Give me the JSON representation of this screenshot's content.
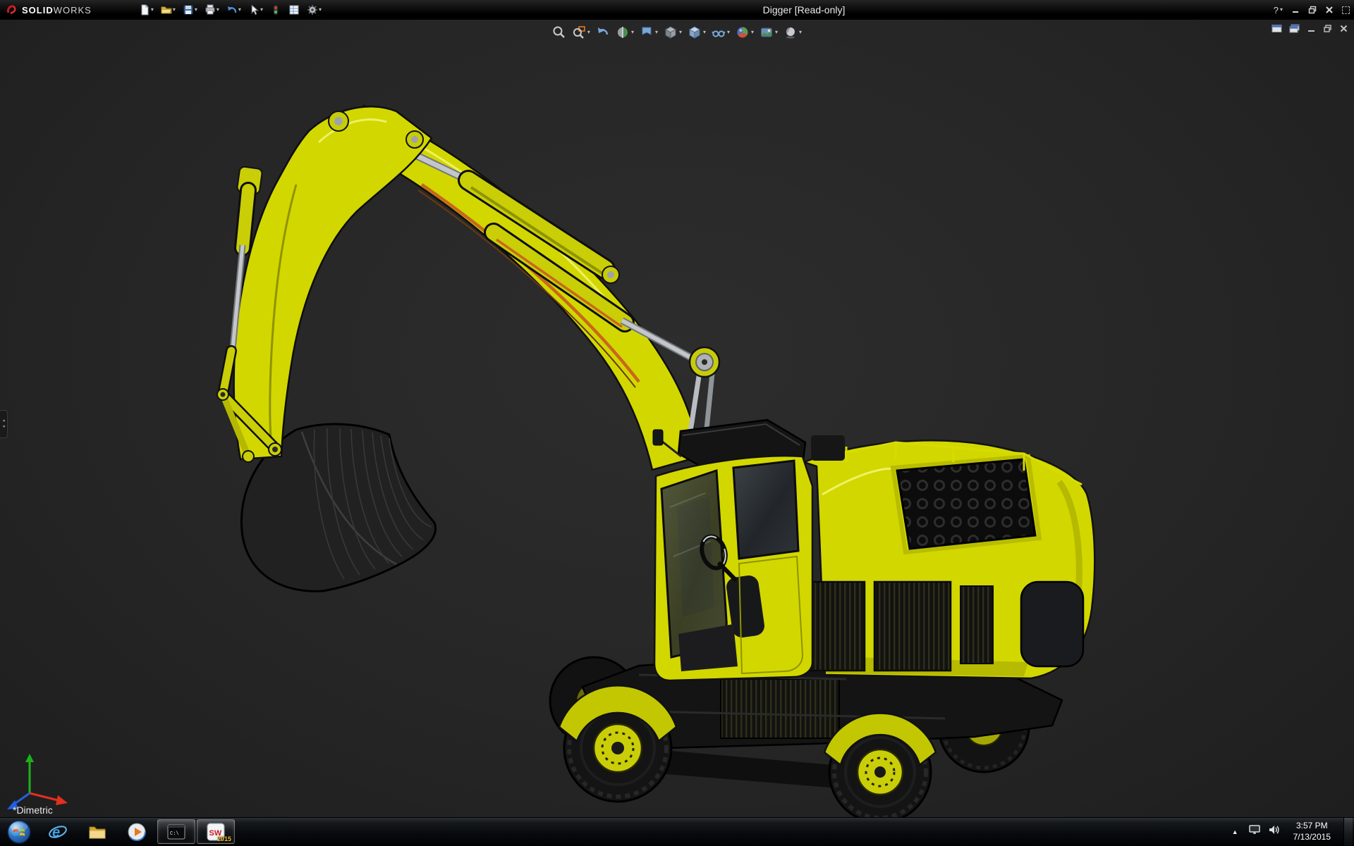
{
  "app": {
    "brand_solid": "SOLID",
    "brand_works": "WORKS",
    "title": "Digger [Read-only]"
  },
  "titlebar": {
    "tools": [
      "new-document",
      "open",
      "save",
      "print",
      "undo",
      "select",
      "rebuild",
      "file-properties",
      "options"
    ],
    "help_label": "?",
    "window_controls": [
      "help",
      "minimize",
      "restore",
      "close",
      "fullscreen-toggle"
    ]
  },
  "headsup_toolbar": {
    "icons": [
      "zoom-to-fit",
      "zoom-to-area",
      "previous-view",
      "section-view",
      "annotation-views",
      "view-orientation",
      "display-style",
      "hide-show-items",
      "edit-appearance",
      "apply-scene",
      "view-settings"
    ]
  },
  "document_window_controls": [
    "new-window",
    "cascade-window",
    "minimize",
    "restore",
    "close"
  ],
  "viewport": {
    "view_label": "*Dimetric",
    "model_name": "Digger",
    "background_color": "#262626",
    "triad_axes": [
      "x-red",
      "y-green",
      "z-blue"
    ]
  },
  "excavator": {
    "body_color": "#d2d700",
    "dark_color": "#1c1c1c",
    "hydraulic_color": "#b9bdc2",
    "accent_stripe_color": "#c8681c",
    "parts": [
      "boom",
      "stick",
      "bucket",
      "boom-cylinder",
      "stick-cylinder",
      "bucket-cylinder",
      "cab",
      "engine-housing",
      "engine-grille",
      "side-vents",
      "chassis",
      "wheels",
      "fenders",
      "handrails"
    ]
  },
  "taskbar": {
    "buttons": [
      "start",
      "internet-explorer",
      "file-explorer",
      "windows-media-player",
      "command-prompt",
      "solidworks-2015"
    ],
    "ie_glyph": "e",
    "cmd_glyph": "C:\\",
    "sw_glyph": "SW",
    "solidworks_badge": "2015",
    "tray": {
      "hidden_icons_arrow": "▲",
      "icons": [
        "display-settings",
        "volume"
      ],
      "time": "3:57 PM",
      "date": "7/13/2015"
    }
  }
}
